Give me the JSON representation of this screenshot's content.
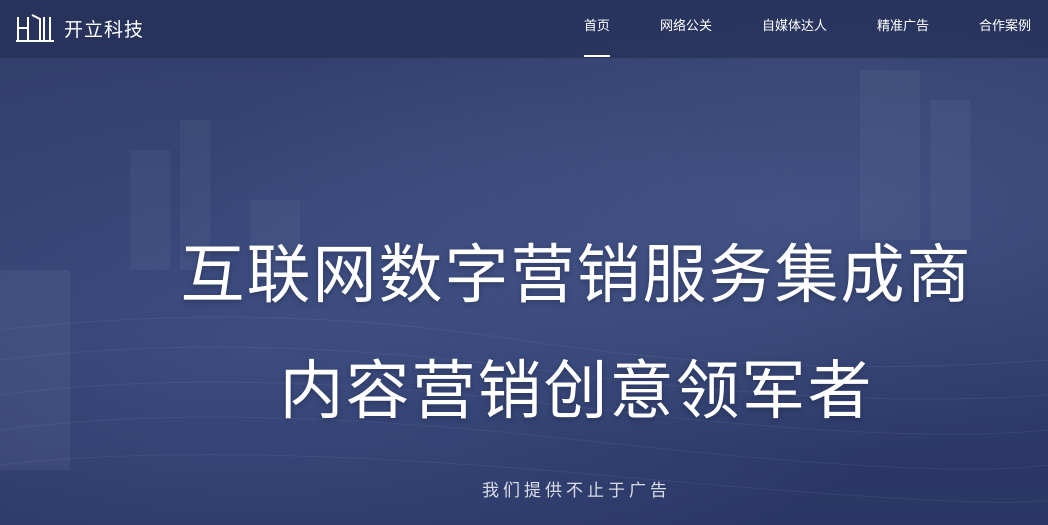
{
  "brand": {
    "name": "开立科技"
  },
  "nav": {
    "items": [
      {
        "label": "首页",
        "active": true
      },
      {
        "label": "网络公关",
        "active": false
      },
      {
        "label": "自媒体达人",
        "active": false
      },
      {
        "label": "精准广告",
        "active": false
      },
      {
        "label": "合作案例",
        "active": false
      }
    ]
  },
  "hero": {
    "headline_line1": "互联网数字营销服务集成商",
    "headline_line2": "内容营销创意领军者",
    "tagline": "我们提供不止于广告"
  },
  "colors": {
    "background": "#2f3d6c",
    "text": "#ffffff"
  }
}
